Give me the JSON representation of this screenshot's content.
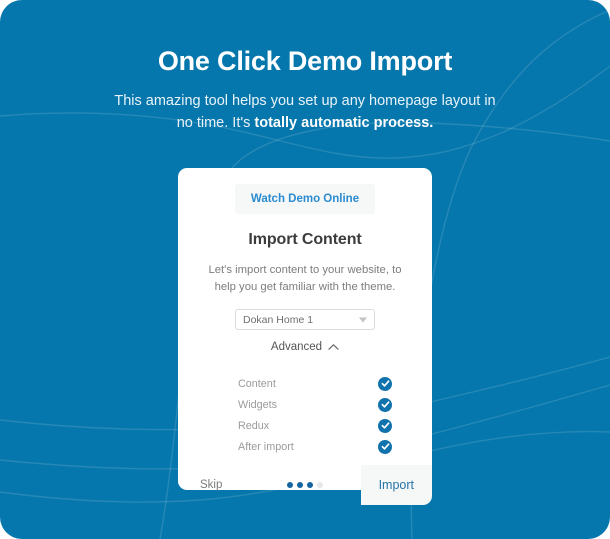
{
  "hero": {
    "title": "One Click Demo Import",
    "subtitle_line1": "This amazing tool helps you set up any homepage layout in",
    "subtitle_line2_prefix": "no time. It's ",
    "subtitle_line2_strong": "totally automatic process."
  },
  "card": {
    "watch_demo_label": "Watch Demo Online",
    "title": "Import Content",
    "description": "Let's import content to your website, to help you get familiar with the theme.",
    "select": {
      "value": "Dokan Home 1",
      "caret_icon": "chevron-down-icon"
    },
    "advanced": {
      "label": "Advanced",
      "caret_icon": "chevron-up-icon",
      "expanded": true
    },
    "checklist": [
      {
        "label": "Content",
        "checked": true
      },
      {
        "label": "Widgets",
        "checked": true
      },
      {
        "label": "Redux",
        "checked": true
      },
      {
        "label": "After import",
        "checked": true
      }
    ],
    "footer": {
      "skip_label": "Skip",
      "import_label": "Import",
      "steps_total": 4,
      "steps_active": 3
    }
  },
  "colors": {
    "background_blue": "#0677ac",
    "accent_blue": "#1173ad",
    "link_blue": "#2b8cd1",
    "import_text": "#2474a8",
    "card_white": "#ffffff",
    "muted_text": "#9b9b9b",
    "dot_active": "#1464a0",
    "dot_inactive": "#e4e8ea"
  }
}
